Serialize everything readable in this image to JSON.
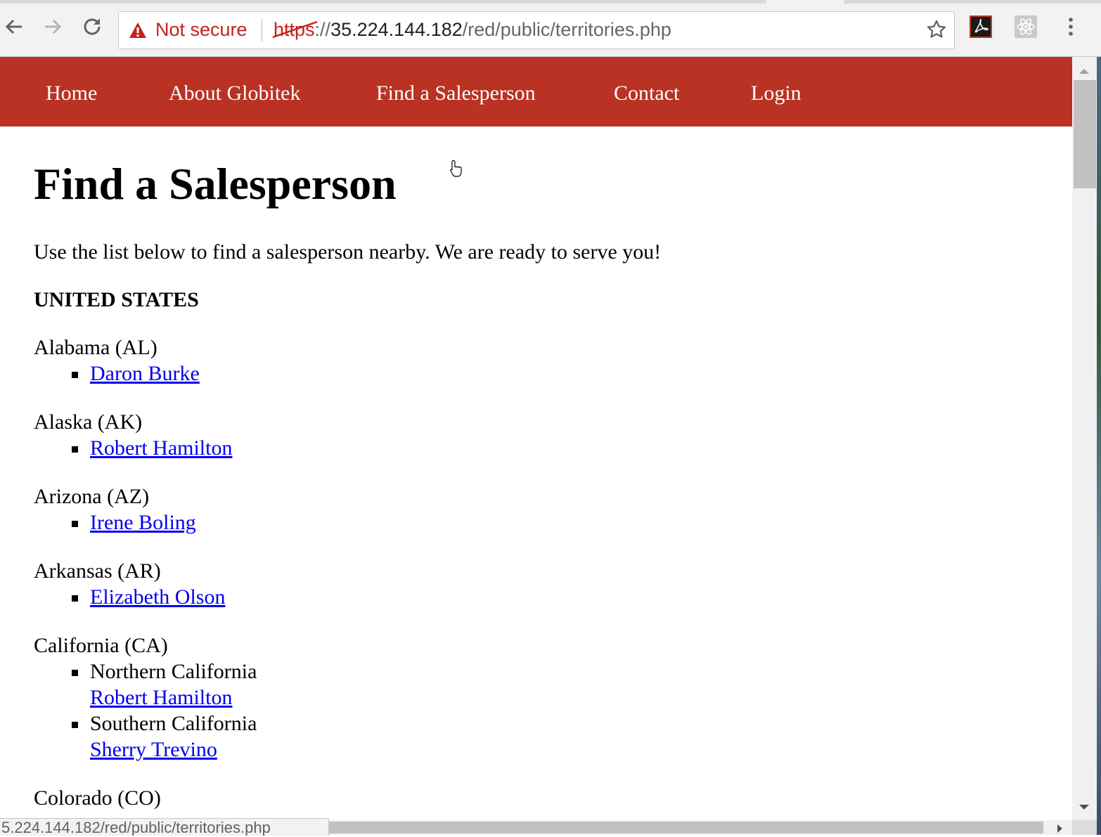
{
  "browser": {
    "security_label": "Not secure",
    "url_scheme": "https",
    "url_separator": "://",
    "url_host": "35.224.144.182",
    "url_path": "/red/public/territories.php",
    "status_url": "5.224.144.182/red/public/territories.php",
    "icons": [
      "back-icon",
      "forward-icon",
      "reload-icon",
      "warning-icon",
      "star-icon",
      "acrobat-icon",
      "react-devtools-icon",
      "menu-icon"
    ]
  },
  "nav": {
    "items": [
      {
        "label": "Home"
      },
      {
        "label": "About Globitek"
      },
      {
        "label": "Find a Salesperson"
      },
      {
        "label": "Contact"
      },
      {
        "label": "Login"
      }
    ],
    "background": "#b93223"
  },
  "page": {
    "title": "Find a Salesperson",
    "intro": "Use the list below to find a salesperson nearby. We are ready to serve you!",
    "region": "UNITED STATES",
    "states": [
      {
        "name": "Alabama (AL)",
        "entries": [
          {
            "salesperson": "Daron Burke"
          }
        ]
      },
      {
        "name": "Alaska (AK)",
        "entries": [
          {
            "salesperson": "Robert Hamilton"
          }
        ]
      },
      {
        "name": "Arizona (AZ)",
        "entries": [
          {
            "salesperson": "Irene Boling"
          }
        ]
      },
      {
        "name": "Arkansas (AR)",
        "entries": [
          {
            "salesperson": "Elizabeth Olson"
          }
        ]
      },
      {
        "name": "California (CA)",
        "entries": [
          {
            "territory": "Northern California",
            "salesperson": "Robert Hamilton"
          },
          {
            "territory": "Southern California",
            "salesperson": "Sherry Trevino"
          }
        ]
      },
      {
        "name": "Colorado (CO)",
        "entries": []
      }
    ]
  }
}
